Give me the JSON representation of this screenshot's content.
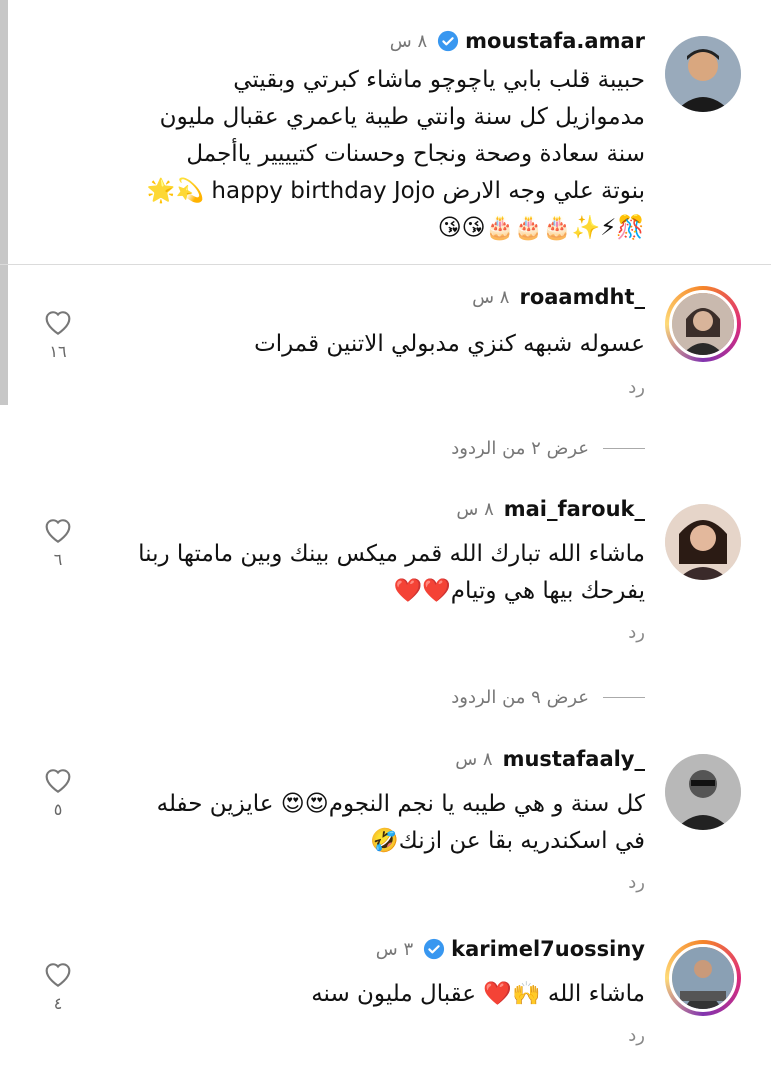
{
  "comments": [
    {
      "username": "moustafa.amar",
      "verified": true,
      "time": "٨ س",
      "text": "حبيبة قلب بابي ياچوچو ماشاء كبرتي وبقيتي\nمدموازيل كل سنة وانتي طيبة ياعمري عقبال مليون\nسنة سعادة وصحة ونجاح وحسنات كتيييير ياأجمل\nبنوتة علي وجه الارض happy birthday Jojo 💫🌟\n🎊⚡✨🎂🎂🎂😘😘",
      "reply": "",
      "likes": ""
    },
    {
      "username": "roaamdht_",
      "verified": false,
      "time": "٨ س",
      "text": "عسوله شبهه كنزي مدبولي الاتنين قمرات",
      "reply": "رد",
      "likes": "١٦"
    },
    {
      "username": "mai_farouk_",
      "verified": false,
      "time": "٨ س",
      "text": "ماشاء الله تبارك الله قمر ميكس بينك وبين مامتها ربنا\nيفرحك بيها هي وتيام❤️❤️",
      "reply": "رد",
      "likes": "٦"
    },
    {
      "username": "mustafaaly_",
      "verified": false,
      "time": "٨ س",
      "text": "كل سنة و هي طيبه يا نجم النجوم😍😍 عايزين حفله\nفي اسكندريه بقا عن ازنك🤣",
      "reply": "رد",
      "likes": "٥"
    },
    {
      "username": "karimel7uossiny",
      "verified": true,
      "time": "٣ س",
      "text": "ماشاء الله 🙌❤️ عقبال مليون سنه",
      "reply": "رد",
      "likes": "٤"
    }
  ],
  "view_replies": [
    {
      "label": "عرض ٢ من الردود"
    },
    {
      "label": "عرض ٩ من الردود"
    }
  ],
  "icons": {
    "verified_color": "#3897f0",
    "like": "heart-outline-icon"
  }
}
